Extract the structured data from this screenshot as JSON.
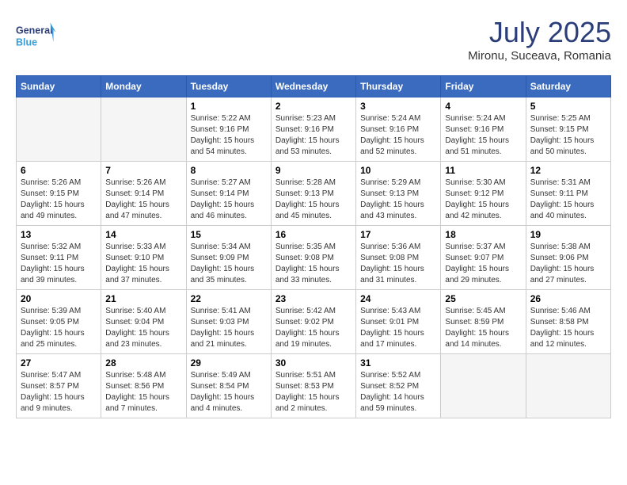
{
  "header": {
    "logo_line1": "General",
    "logo_line2": "Blue",
    "month_year": "July 2025",
    "location": "Mironu, Suceava, Romania"
  },
  "weekdays": [
    "Sunday",
    "Monday",
    "Tuesday",
    "Wednesday",
    "Thursday",
    "Friday",
    "Saturday"
  ],
  "weeks": [
    [
      {
        "day": "",
        "empty": true
      },
      {
        "day": "",
        "empty": true
      },
      {
        "day": "1",
        "sunrise": "Sunrise: 5:22 AM",
        "sunset": "Sunset: 9:16 PM",
        "daylight": "Daylight: 15 hours and 54 minutes."
      },
      {
        "day": "2",
        "sunrise": "Sunrise: 5:23 AM",
        "sunset": "Sunset: 9:16 PM",
        "daylight": "Daylight: 15 hours and 53 minutes."
      },
      {
        "day": "3",
        "sunrise": "Sunrise: 5:24 AM",
        "sunset": "Sunset: 9:16 PM",
        "daylight": "Daylight: 15 hours and 52 minutes."
      },
      {
        "day": "4",
        "sunrise": "Sunrise: 5:24 AM",
        "sunset": "Sunset: 9:16 PM",
        "daylight": "Daylight: 15 hours and 51 minutes."
      },
      {
        "day": "5",
        "sunrise": "Sunrise: 5:25 AM",
        "sunset": "Sunset: 9:15 PM",
        "daylight": "Daylight: 15 hours and 50 minutes."
      }
    ],
    [
      {
        "day": "6",
        "sunrise": "Sunrise: 5:26 AM",
        "sunset": "Sunset: 9:15 PM",
        "daylight": "Daylight: 15 hours and 49 minutes."
      },
      {
        "day": "7",
        "sunrise": "Sunrise: 5:26 AM",
        "sunset": "Sunset: 9:14 PM",
        "daylight": "Daylight: 15 hours and 47 minutes."
      },
      {
        "day": "8",
        "sunrise": "Sunrise: 5:27 AM",
        "sunset": "Sunset: 9:14 PM",
        "daylight": "Daylight: 15 hours and 46 minutes."
      },
      {
        "day": "9",
        "sunrise": "Sunrise: 5:28 AM",
        "sunset": "Sunset: 9:13 PM",
        "daylight": "Daylight: 15 hours and 45 minutes."
      },
      {
        "day": "10",
        "sunrise": "Sunrise: 5:29 AM",
        "sunset": "Sunset: 9:13 PM",
        "daylight": "Daylight: 15 hours and 43 minutes."
      },
      {
        "day": "11",
        "sunrise": "Sunrise: 5:30 AM",
        "sunset": "Sunset: 9:12 PM",
        "daylight": "Daylight: 15 hours and 42 minutes."
      },
      {
        "day": "12",
        "sunrise": "Sunrise: 5:31 AM",
        "sunset": "Sunset: 9:11 PM",
        "daylight": "Daylight: 15 hours and 40 minutes."
      }
    ],
    [
      {
        "day": "13",
        "sunrise": "Sunrise: 5:32 AM",
        "sunset": "Sunset: 9:11 PM",
        "daylight": "Daylight: 15 hours and 39 minutes."
      },
      {
        "day": "14",
        "sunrise": "Sunrise: 5:33 AM",
        "sunset": "Sunset: 9:10 PM",
        "daylight": "Daylight: 15 hours and 37 minutes."
      },
      {
        "day": "15",
        "sunrise": "Sunrise: 5:34 AM",
        "sunset": "Sunset: 9:09 PM",
        "daylight": "Daylight: 15 hours and 35 minutes."
      },
      {
        "day": "16",
        "sunrise": "Sunrise: 5:35 AM",
        "sunset": "Sunset: 9:08 PM",
        "daylight": "Daylight: 15 hours and 33 minutes."
      },
      {
        "day": "17",
        "sunrise": "Sunrise: 5:36 AM",
        "sunset": "Sunset: 9:08 PM",
        "daylight": "Daylight: 15 hours and 31 minutes."
      },
      {
        "day": "18",
        "sunrise": "Sunrise: 5:37 AM",
        "sunset": "Sunset: 9:07 PM",
        "daylight": "Daylight: 15 hours and 29 minutes."
      },
      {
        "day": "19",
        "sunrise": "Sunrise: 5:38 AM",
        "sunset": "Sunset: 9:06 PM",
        "daylight": "Daylight: 15 hours and 27 minutes."
      }
    ],
    [
      {
        "day": "20",
        "sunrise": "Sunrise: 5:39 AM",
        "sunset": "Sunset: 9:05 PM",
        "daylight": "Daylight: 15 hours and 25 minutes."
      },
      {
        "day": "21",
        "sunrise": "Sunrise: 5:40 AM",
        "sunset": "Sunset: 9:04 PM",
        "daylight": "Daylight: 15 hours and 23 minutes."
      },
      {
        "day": "22",
        "sunrise": "Sunrise: 5:41 AM",
        "sunset": "Sunset: 9:03 PM",
        "daylight": "Daylight: 15 hours and 21 minutes."
      },
      {
        "day": "23",
        "sunrise": "Sunrise: 5:42 AM",
        "sunset": "Sunset: 9:02 PM",
        "daylight": "Daylight: 15 hours and 19 minutes."
      },
      {
        "day": "24",
        "sunrise": "Sunrise: 5:43 AM",
        "sunset": "Sunset: 9:01 PM",
        "daylight": "Daylight: 15 hours and 17 minutes."
      },
      {
        "day": "25",
        "sunrise": "Sunrise: 5:45 AM",
        "sunset": "Sunset: 8:59 PM",
        "daylight": "Daylight: 15 hours and 14 minutes."
      },
      {
        "day": "26",
        "sunrise": "Sunrise: 5:46 AM",
        "sunset": "Sunset: 8:58 PM",
        "daylight": "Daylight: 15 hours and 12 minutes."
      }
    ],
    [
      {
        "day": "27",
        "sunrise": "Sunrise: 5:47 AM",
        "sunset": "Sunset: 8:57 PM",
        "daylight": "Daylight: 15 hours and 9 minutes."
      },
      {
        "day": "28",
        "sunrise": "Sunrise: 5:48 AM",
        "sunset": "Sunset: 8:56 PM",
        "daylight": "Daylight: 15 hours and 7 minutes."
      },
      {
        "day": "29",
        "sunrise": "Sunrise: 5:49 AM",
        "sunset": "Sunset: 8:54 PM",
        "daylight": "Daylight: 15 hours and 4 minutes."
      },
      {
        "day": "30",
        "sunrise": "Sunrise: 5:51 AM",
        "sunset": "Sunset: 8:53 PM",
        "daylight": "Daylight: 15 hours and 2 minutes."
      },
      {
        "day": "31",
        "sunrise": "Sunrise: 5:52 AM",
        "sunset": "Sunset: 8:52 PM",
        "daylight": "Daylight: 14 hours and 59 minutes."
      },
      {
        "day": "",
        "empty": true
      },
      {
        "day": "",
        "empty": true
      }
    ]
  ]
}
